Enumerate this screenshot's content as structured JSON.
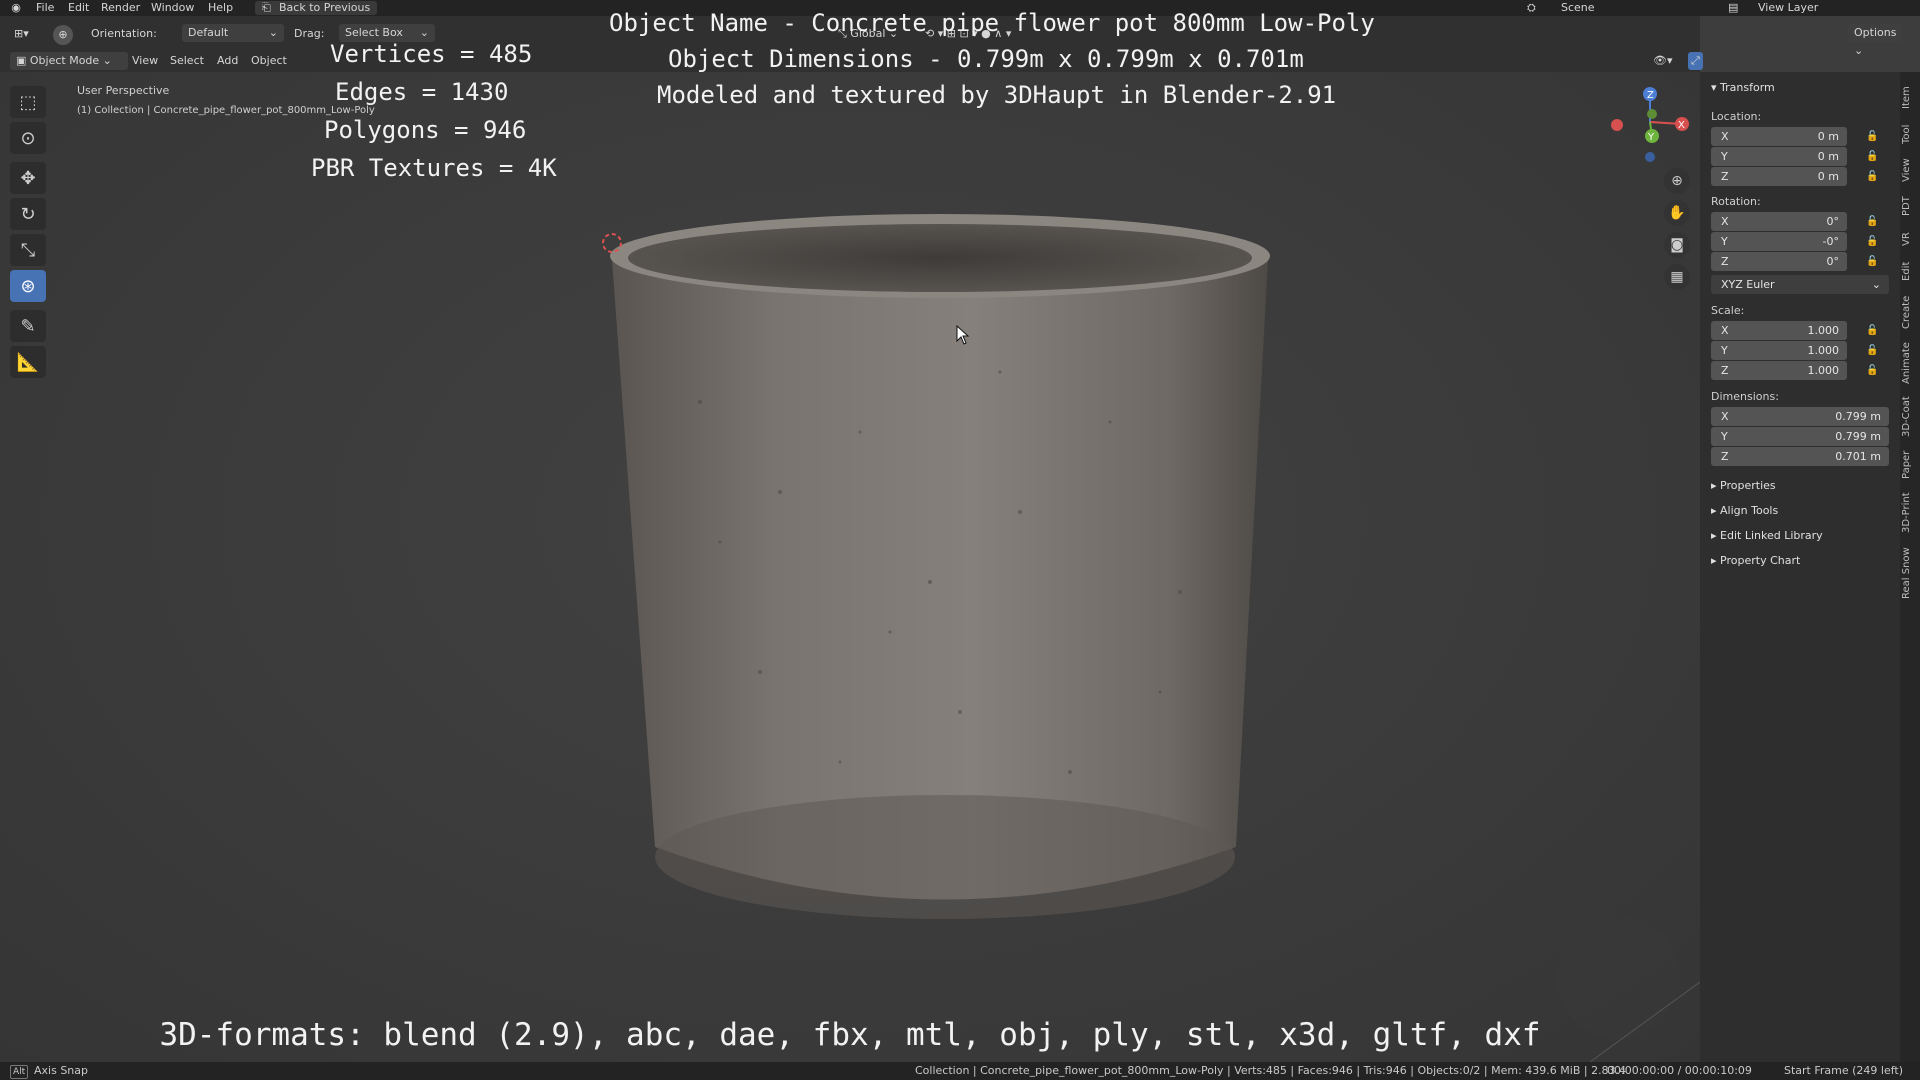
{
  "menu": {
    "file": "File",
    "edit": "Edit",
    "render": "Render",
    "window": "Window",
    "help": "Help",
    "back": "Back to Previous",
    "scene": "Scene",
    "view_layer": "View Layer"
  },
  "header": {
    "orientation_label": "Orientation:",
    "orientation_value": "Default",
    "drag_label": "Drag:",
    "drag_value": "Select Box",
    "transform_orientation": "Global",
    "options": "Options",
    "mode": "Object Mode",
    "view": "View",
    "select": "Select",
    "add": "Add",
    "object": "Object"
  },
  "viewport": {
    "perspective": "User Perspective",
    "collection": "(1) Collection | Concrete_pipe_flower_pot_800mm_Low-Poly"
  },
  "overlay": {
    "vertices": "Vertices = 485",
    "edges": "Edges = 1430",
    "polygons": "Polygons = 946",
    "textures": "PBR Textures = 4K",
    "object_name": "Object Name - Concrete pipe flower pot 800mm Low-Poly",
    "dimensions": "Object Dimensions -  0.799m x 0.799m x 0.701m",
    "modeled_by": "Modeled and textured by 3DHaupt in Blender-2.91",
    "formats": "3D-formats: blend (2.9), abc, dae, fbx, mtl, obj, ply, stl, x3d, gltf, dxf"
  },
  "gizmo": {
    "z": "Z",
    "y": "Y",
    "x": "X"
  },
  "panel": {
    "transform": "Transform",
    "location_label": "Location:",
    "location": [
      {
        "axis": "X",
        "val": "0 m"
      },
      {
        "axis": "Y",
        "val": "0 m"
      },
      {
        "axis": "Z",
        "val": "0 m"
      }
    ],
    "rotation_label": "Rotation:",
    "rotation": [
      {
        "axis": "X",
        "val": "0°"
      },
      {
        "axis": "Y",
        "val": "-0°"
      },
      {
        "axis": "Z",
        "val": "0°"
      }
    ],
    "rotation_mode": "XYZ Euler",
    "scale_label": "Scale:",
    "scale": [
      {
        "axis": "X",
        "val": "1.000"
      },
      {
        "axis": "Y",
        "val": "1.000"
      },
      {
        "axis": "Z",
        "val": "1.000"
      }
    ],
    "dimensions_label": "Dimensions:",
    "dimensions": [
      {
        "axis": "X",
        "val": "0.799 m"
      },
      {
        "axis": "Y",
        "val": "0.799 m"
      },
      {
        "axis": "Z",
        "val": "0.701 m"
      }
    ],
    "sections": [
      "Properties",
      "Align Tools",
      "Edit Linked Library",
      "Property Chart"
    ]
  },
  "tabs": [
    "Item",
    "Tool",
    "View",
    "PDT",
    "VR",
    "Edit",
    "Create",
    "Animate",
    "3D-Coat",
    "Paper",
    "3D-Print",
    "Real Snow"
  ],
  "status": {
    "axis_snap": "Axis Snap",
    "info": "Collection | Concrete_pipe_flower_pot_800mm_Low-Poly | Verts:485 | Faces:946 | Tris:946 | Objects:0/2 | Mem: 439.6 MiB | 2.83.4",
    "time": "00:00:00:00 / 00:00:10:09",
    "frame": "Start Frame (249 left)"
  },
  "colors": {
    "accent": "#4772b3",
    "background": "#3d3d3d"
  }
}
